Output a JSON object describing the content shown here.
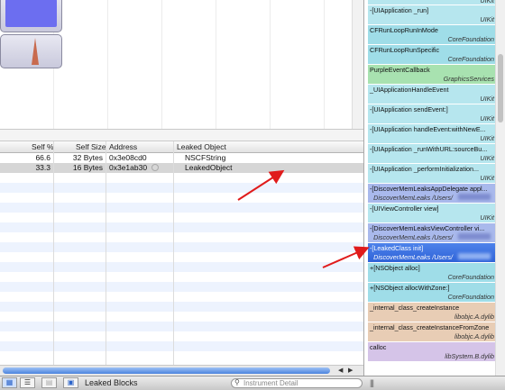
{
  "table": {
    "headers": {
      "self_pct": "Self %",
      "self_size": "Self Size",
      "address": "Address",
      "leaked_object": "Leaked Object"
    },
    "rows": [
      {
        "self_pct": "66.6",
        "self_size": "32 Bytes",
        "address": "0x3e08cd0",
        "leaked_object": "NSCFString"
      },
      {
        "self_pct": "33.3",
        "self_size": "16 Bytes",
        "address": "0x3e1ab30",
        "leaked_object": "LeakedObject"
      }
    ]
  },
  "bottom_bar": {
    "detail_label": "Leaked Blocks",
    "search_placeholder": "Instrument Detail"
  },
  "stack": {
    "frames": [
      {
        "fn": "",
        "lib": "UIKit",
        "color": "#b6e6ee"
      },
      {
        "fn": "-[UIApplication _run]",
        "lib": "UIKit",
        "color": "#b6e6ee"
      },
      {
        "fn": "CFRunLoopRunInMode",
        "lib": "CoreFoundation",
        "color": "#9fdde8"
      },
      {
        "fn": "CFRunLoopRunSpecific",
        "lib": "CoreFoundation",
        "color": "#9fdde8"
      },
      {
        "fn": "PurpleEventCallback",
        "lib": "GraphicsServices",
        "color": "#a8e2b0"
      },
      {
        "fn": "_UIApplicationHandleEvent",
        "lib": "UIKit",
        "color": "#b6e6ee"
      },
      {
        "fn": "-[UIApplication sendEvent:]",
        "lib": "UIKit",
        "color": "#b6e6ee"
      },
      {
        "fn": "-[UIApplication handleEvent:withNewE...",
        "lib": "UIKit",
        "color": "#b6e6ee"
      },
      {
        "fn": "-[UIApplication _runWithURL:sourceBu...",
        "lib": "UIKit",
        "color": "#b6e6ee"
      },
      {
        "fn": "-[UIApplication _performInitialization...",
        "lib": "UIKit",
        "color": "#b6e6ee"
      },
      {
        "fn": "-[DiscoverMemLeaksAppDelegate appl...",
        "lib": "DiscoverMemLeaks /Users/",
        "color": "#a9b9ec"
      },
      {
        "fn": "-[UIViewController view]",
        "lib": "UIKit",
        "color": "#b6e6ee"
      },
      {
        "fn": "-[DiscoverMemLeaksViewController vi...",
        "lib": "DiscoverMemLeaks /Users/",
        "color": "#a9b9ec"
      },
      {
        "fn": "-[LeakedClass init]",
        "lib": "DiscoverMemLeaks /Users/",
        "color": "#2f63d8",
        "selected": true
      },
      {
        "fn": "+[NSObject alloc]",
        "lib": "CoreFoundation",
        "color": "#9fdde8"
      },
      {
        "fn": "+[NSObject allocWithZone:]",
        "lib": "CoreFoundation",
        "color": "#9fdde8"
      },
      {
        "fn": "_internal_class_createInstance",
        "lib": "libobjc.A.dylib",
        "color": "#e8cdb5"
      },
      {
        "fn": "_internal_class_createInstanceFromZone",
        "lib": "libobjc.A.dylib",
        "color": "#e8cdb5"
      },
      {
        "fn": "calloc",
        "lib": "libSystem.B.dylib",
        "color": "#d5c4e8"
      }
    ]
  }
}
